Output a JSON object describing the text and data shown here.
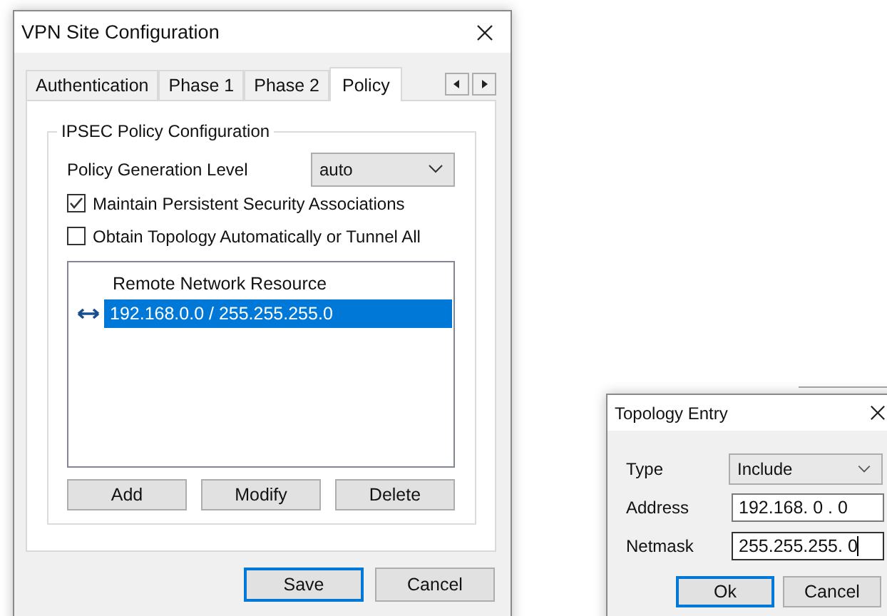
{
  "main_dialog": {
    "title": "VPN Site Configuration",
    "tabs": [
      {
        "label": "Authentication",
        "selected": false
      },
      {
        "label": "Phase 1",
        "selected": false
      },
      {
        "label": "Phase 2",
        "selected": false
      },
      {
        "label": "Policy",
        "selected": true
      }
    ],
    "group_title": "IPSEC Policy Configuration",
    "policy_level": {
      "label": "Policy Generation Level",
      "value": "auto"
    },
    "checkboxes": [
      {
        "label": "Maintain Persistent Security Associations",
        "checked": true
      },
      {
        "label": "Obtain Topology Automatically or Tunnel All",
        "checked": false
      }
    ],
    "list": {
      "column": "Remote Network Resource",
      "rows": [
        {
          "text": "192.168.0.0 / 255.255.255.0",
          "selected": true
        }
      ]
    },
    "list_buttons": [
      "Add",
      "Modify",
      "Delete"
    ],
    "footer_buttons": [
      {
        "label": "Save",
        "default": true
      },
      {
        "label": "Cancel",
        "default": false
      }
    ]
  },
  "topology_entry": {
    "title": "Topology Entry",
    "type": {
      "label": "Type",
      "value": "Include"
    },
    "fields": [
      {
        "label": "Address",
        "value": "192.168. 0 . 0",
        "focused": false
      },
      {
        "label": "Netmask",
        "value": "255.255.255. 0",
        "focused": true
      }
    ],
    "buttons": [
      {
        "label": "Ok",
        "default": true
      },
      {
        "label": "Cancel",
        "default": false
      }
    ]
  }
}
